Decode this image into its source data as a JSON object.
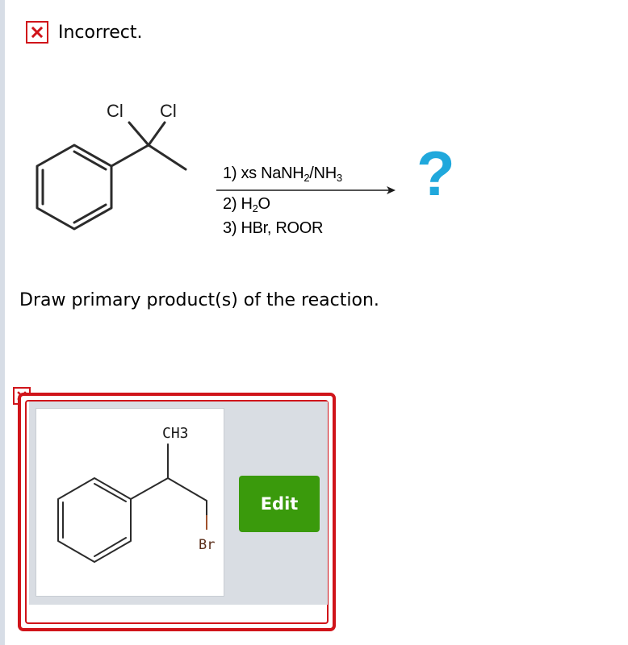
{
  "feedback": {
    "status_text": "Incorrect.",
    "status_icon": "close-icon",
    "status_color": "#d0141a"
  },
  "reaction": {
    "reactant_labels": {
      "cl_left": "Cl",
      "cl_right": "Cl"
    },
    "reagent_1": {
      "prefix": "1) xs NaNH",
      "sub1": "2",
      "mid": "/NH",
      "sub2": "3"
    },
    "reagent_2": {
      "prefix": "2) H",
      "sub1": "2",
      "suffix": "O"
    },
    "reagent_3": "3) HBr, ROOR",
    "product_placeholder": "?",
    "placeholder_color": "#20a8dc"
  },
  "question": {
    "prompt": "Draw primary product(s) of the reaction."
  },
  "answer": {
    "mark_icon": "close-icon",
    "structure_labels": {
      "methyl": "CH3",
      "bromine": "Br"
    },
    "edit_label": "Edit",
    "edit_color": "#3a9a0c"
  }
}
